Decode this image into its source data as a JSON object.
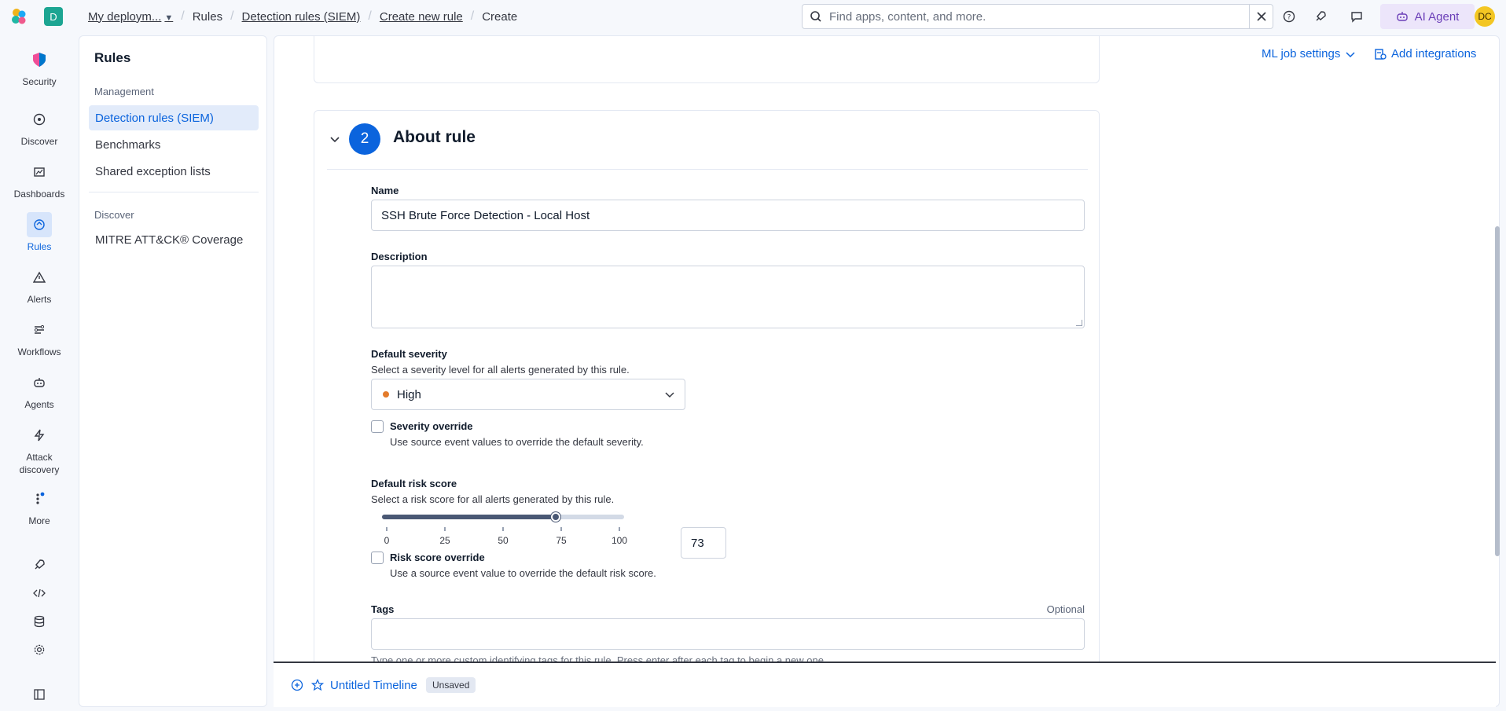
{
  "topbar": {
    "space_initial": "D",
    "breadcrumbs": [
      "My deploym...",
      "Rules",
      "Detection rules (SIEM)",
      "Create new rule",
      "Create"
    ],
    "search_placeholder": "Find apps, content, and more.",
    "ai_agent_label": "AI Agent",
    "avatar_initials": "DC"
  },
  "rail": {
    "items": [
      {
        "label": "Security",
        "icon": "security-logo-icon"
      },
      {
        "label": "Discover",
        "icon": "compass-icon"
      },
      {
        "label": "Dashboards",
        "icon": "dashboard-icon"
      },
      {
        "label": "Rules",
        "icon": "rules-icon",
        "active": true
      },
      {
        "label": "Alerts",
        "icon": "warning-icon"
      },
      {
        "label": "Workflows",
        "icon": "workflow-icon"
      },
      {
        "label": "Agents",
        "icon": "robot-icon"
      },
      {
        "label": "Attack discovery",
        "icon": "bolt-icon"
      },
      {
        "label": "More",
        "icon": "dots-icon"
      }
    ]
  },
  "subnav": {
    "title": "Rules",
    "groups": [
      {
        "label": "Management",
        "items": [
          "Detection rules (SIEM)",
          "Benchmarks",
          "Shared exception lists"
        ]
      },
      {
        "label": "Discover",
        "items": [
          "MITRE ATT&CK® Coverage"
        ]
      }
    ]
  },
  "header_links": {
    "ml_job_settings": "ML job settings",
    "add_integrations": "Add integrations"
  },
  "about_rule": {
    "step": "2",
    "title": "About rule",
    "name_label": "Name",
    "name_value": "SSH Brute Force Detection - Local Host",
    "description_label": "Description",
    "description_value": "",
    "severity_label": "Default severity",
    "severity_help": "Select a severity level for all alerts generated by this rule.",
    "severity_value": "High",
    "severity_color": "#e37b2b",
    "severity_override_label": "Severity override",
    "severity_override_help": "Use source event values to override the default severity.",
    "risk_label": "Default risk score",
    "risk_help": "Select a risk score for all alerts generated by this rule.",
    "risk_value": 73,
    "risk_value_text": "73",
    "risk_ticks": [
      "0",
      "25",
      "50",
      "75",
      "100"
    ],
    "risk_override_label": "Risk score override",
    "risk_override_help": "Use a source event value to override the default risk score.",
    "tags_label": "Tags",
    "tags_optional": "Optional",
    "tags_help": "Type one or more custom identifying tags for this rule. Press enter after each tag to begin a new one."
  },
  "timeline": {
    "title": "Untitled Timeline",
    "status": "Unsaved"
  },
  "colors": {
    "accent": "#0b64dd",
    "space_badge": "#1ca592"
  }
}
